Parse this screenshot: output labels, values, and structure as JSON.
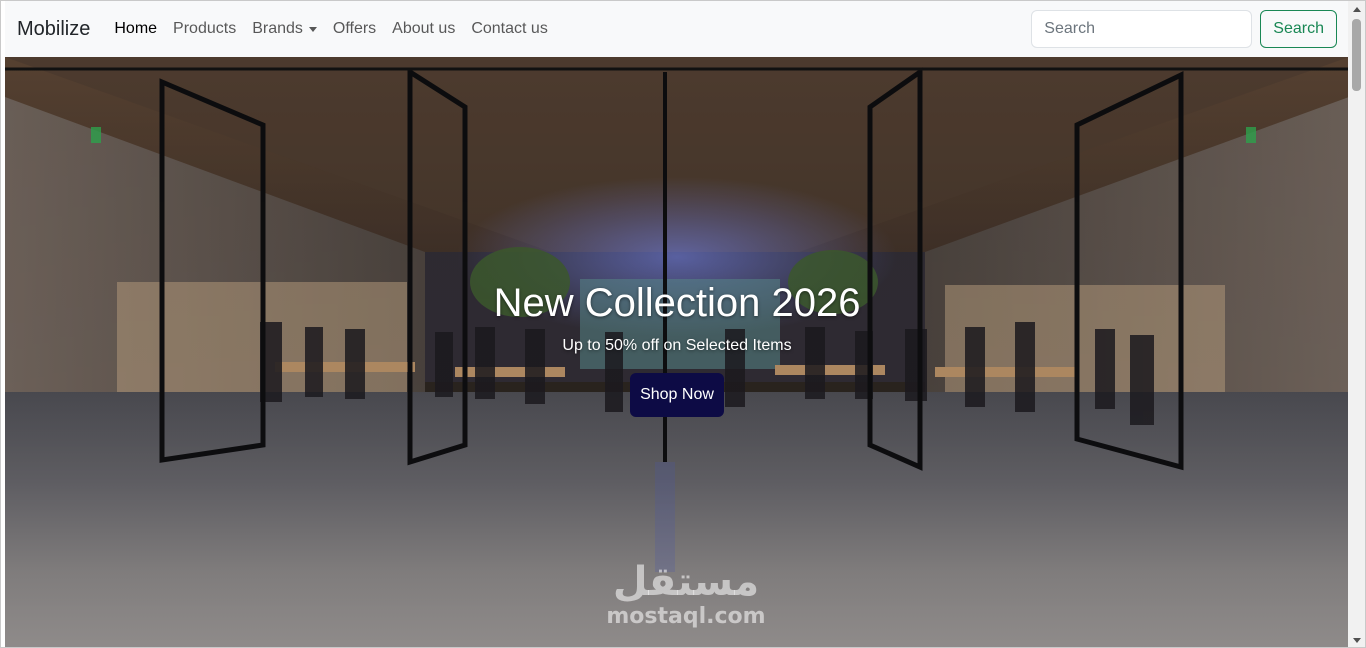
{
  "navbar": {
    "brand": "Mobilize",
    "links": [
      {
        "label": "Home",
        "active": true
      },
      {
        "label": "Products",
        "active": false
      },
      {
        "label": "Brands",
        "active": false,
        "dropdown": true
      },
      {
        "label": "Offers",
        "active": false
      },
      {
        "label": "About us",
        "active": false
      },
      {
        "label": "Contact us",
        "active": false
      }
    ],
    "search": {
      "placeholder": "Search",
      "button_label": "Search"
    }
  },
  "hero": {
    "title": "New Collection 2026",
    "subtitle": "Up to 50% off on Selected Items",
    "cta_label": "Shop Now",
    "background_image": "store-interior-image"
  },
  "watermark": {
    "arabic": "مستقل",
    "latin": "mostaql.com"
  },
  "colors": {
    "navbar_bg": "#f8f9fa",
    "search_accent": "#198754",
    "cta_bg": "#0d0b45"
  }
}
